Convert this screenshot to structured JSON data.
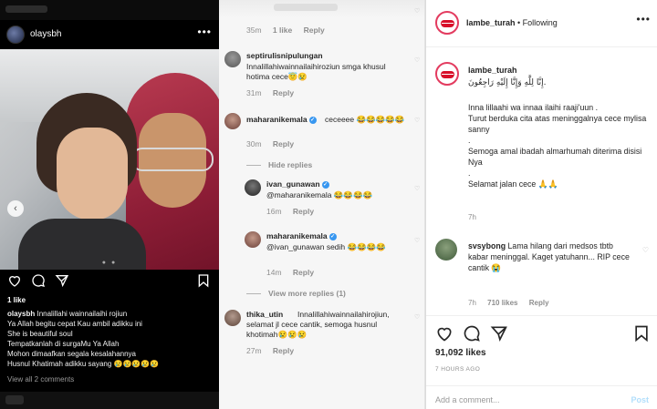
{
  "left_post": {
    "username": "olaysbh",
    "likes": "1 like",
    "caption_user": "olaysbh",
    "caption_lines": [
      "Innalillahi wainnailaihi rojiun",
      "Ya Allah begitu cepat Kau ambil adikku ini",
      "She is beautiful soul",
      "Tempatkanlah di surgaMu Ya Allah",
      "Mohon dimaafkan segala kesalahannya",
      "Husnul Khatimah adikku sayang 😢😢😢😢😢"
    ],
    "view_all": "View all 2 comments"
  },
  "middle_comments": {
    "top_meta": {
      "time": "35m",
      "likes": "1 like",
      "reply": "Reply"
    },
    "comments": [
      {
        "user": "septirulisnipulungan",
        "text": "Innalillahiwainnailaihiroziun smga khusul hotima cece😇😢",
        "time": "31m",
        "reply": "Reply",
        "verified": false
      },
      {
        "user": "maharanikemala",
        "text": "ceceeee 😂😂😂😂😂",
        "time": "30m",
        "reply": "Reply",
        "verified": true
      }
    ],
    "hide_replies": "Hide replies",
    "replies": [
      {
        "user": "ivan_gunawan",
        "text": "@maharanikemala 😂😂😂😂",
        "time": "16m",
        "reply": "Reply",
        "verified": true
      },
      {
        "user": "maharanikemala",
        "text": "@ivan_gunawan sedih 😂😂😂😂",
        "time": "14m",
        "reply": "Reply",
        "verified": true
      }
    ],
    "view_more_replies": "View more replies (1)",
    "last_comment": {
      "user": "thika_utin",
      "text": "Innalillahiwainnailahirojiun, selamat jl cece cantik, semoga husnul khotimah😢😢😢",
      "time": "27m",
      "reply": "Reply"
    }
  },
  "right_post": {
    "header_user": "lambe_turah",
    "header_follow": " • Following",
    "caption_user": "lambe_turah",
    "caption_arabic": "إِنَّا لِلَّٰهِ وَإِنَّا إِلَيْهِ رَاجِعُونَ.",
    "caption_lines": [
      "Inna lillaahi wa innaa ilaihi raaji'uun .",
      "Turut berduka cita atas meninggalnya cece mylisa sanny",
      ".",
      "Semoga amal ibadah almarhumah diterima disisi Nya",
      ".",
      "Selamat jalan cece 🙏🙏"
    ],
    "caption_time": "7h",
    "comment": {
      "user": "svsybong",
      "text": "Lama hilang dari medsos tbtb kabar meninggal. Kaget yatuhann... RIP cece cantik 😭",
      "time": "7h",
      "likes": "710 likes",
      "reply": "Reply"
    },
    "likes": "91,092 likes",
    "post_time": "7 HOURS AGO",
    "add_comment_placeholder": "Add a comment...",
    "post_button": "Post"
  }
}
